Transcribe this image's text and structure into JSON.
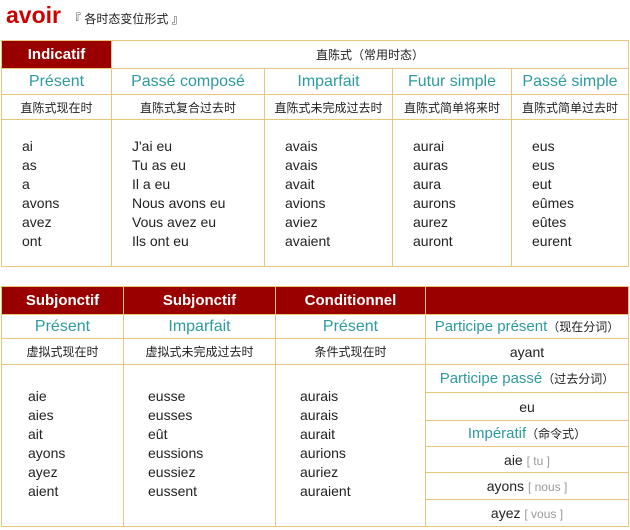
{
  "header": {
    "verb": "avoir",
    "subtitle": "『 各时态变位形式 』"
  },
  "indicatif": {
    "mood": "Indicatif",
    "mood_cn": "直陈式（常用时态）",
    "tenses": [
      {
        "name": "Présent",
        "cn": "直陈式现在时",
        "forms": [
          "ai",
          "as",
          "a",
          "avons",
          "avez",
          "ont"
        ]
      },
      {
        "name": "Passé composé",
        "cn": "直陈式复合过去时",
        "forms": [
          "J'ai eu",
          "Tu as eu",
          "Il a eu",
          "Nous avons eu",
          "Vous avez eu",
          "Ils ont eu"
        ]
      },
      {
        "name": "Imparfait",
        "cn": "直陈式未完成过去时",
        "forms": [
          "avais",
          "avais",
          "avait",
          "avions",
          "aviez",
          "avaient"
        ]
      },
      {
        "name": "Futur simple",
        "cn": "直陈式简单将来时",
        "forms": [
          "aurai",
          "auras",
          "aura",
          "aurons",
          "aurez",
          "auront"
        ]
      },
      {
        "name": "Passé simple",
        "cn": "直陈式简单过去时",
        "forms": [
          "eus",
          "eus",
          "eut",
          "eûmes",
          "eûtes",
          "eurent"
        ]
      }
    ]
  },
  "lower": {
    "moods": [
      "Subjonctif",
      "Subjonctif",
      "Conditionnel"
    ],
    "tenses": [
      {
        "name": "Présent",
        "cn": "虚拟式现在时",
        "forms": [
          "aie",
          "aies",
          "ait",
          "ayons",
          "ayez",
          "aient"
        ]
      },
      {
        "name": "Imparfait",
        "cn": "虚拟式未完成过去时",
        "forms": [
          "eusse",
          "eusses",
          "eût",
          "eussions",
          "eussiez",
          "eussent"
        ]
      },
      {
        "name": "Présent",
        "cn": "条件式现在时",
        "forms": [
          "aurais",
          "aurais",
          "aurait",
          "aurions",
          "auriez",
          "auraient"
        ]
      }
    ],
    "participe_present": {
      "label": "Participe présent",
      "cn": "（现在分词）",
      "value": "ayant"
    },
    "participe_passe": {
      "label": "Participe passé",
      "cn": "（过去分词）",
      "value": "eu"
    },
    "imperatif": {
      "label": "Impératif",
      "cn": "（命令式）",
      "items": [
        {
          "form": "aie",
          "pron": "[ tu ]"
        },
        {
          "form": "ayons",
          "pron": "[ nous ]"
        },
        {
          "form": "ayez",
          "pron": "[ vous ]"
        }
      ]
    }
  }
}
